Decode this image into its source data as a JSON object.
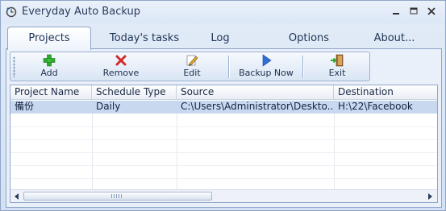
{
  "window": {
    "title": "Everyday Auto Backup",
    "controls": [
      "minimize",
      "maximize",
      "close"
    ]
  },
  "tabs": [
    {
      "label": "Projects",
      "active": true
    },
    {
      "label": "Today's tasks",
      "active": false
    },
    {
      "label": "Log",
      "active": false
    },
    {
      "label": "Options",
      "active": false
    },
    {
      "label": "About...",
      "active": false
    }
  ],
  "toolbar": {
    "add_label": "Add",
    "remove_label": "Remove",
    "edit_label": "Edit",
    "backup_now_label": "Backup Now",
    "exit_label": "Exit"
  },
  "icons": {
    "add": "plus-icon",
    "remove": "x-icon",
    "edit": "pencil-icon",
    "backup_now": "play-icon",
    "exit": "exit-door-icon"
  },
  "colors": {
    "add": "#2fa82f",
    "remove": "#d12b2b",
    "backup_now": "#2f6fd6",
    "selection": "#c8d8ef"
  },
  "table": {
    "columns": [
      "Project Name",
      "Schedule Type",
      "Source",
      "Destination"
    ],
    "rows": [
      {
        "project_name": "備份",
        "schedule_type": "Daily",
        "source": "C:\\Users\\Administrator\\Deskto...",
        "destination": "H:\\22\\Facebook",
        "selected": true
      }
    ]
  }
}
